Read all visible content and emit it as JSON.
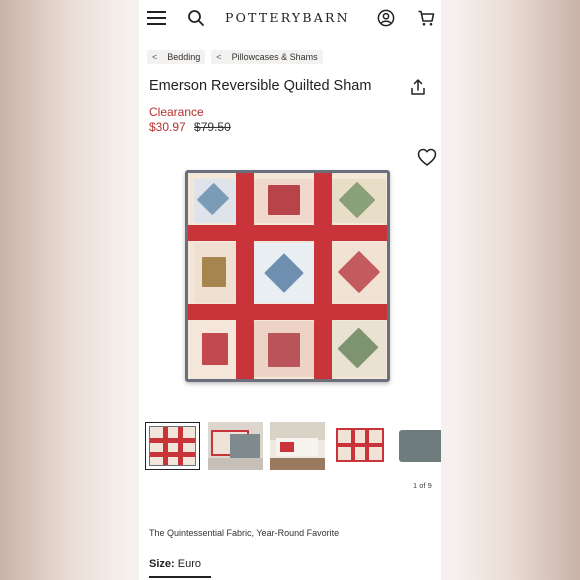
{
  "header": {
    "brand": "POTTERYBARN",
    "icons": [
      "menu-icon",
      "search-icon",
      "account-icon",
      "cart-icon"
    ]
  },
  "breadcrumbs": [
    {
      "label": "Bedding"
    },
    {
      "label": "Pillowcases & Shams"
    }
  ],
  "product": {
    "title": "Emerson Reversible Quilted Sham",
    "clearance_label": "Clearance",
    "sale_price": "$30.97",
    "original_price": "$79.50",
    "tagline": "The Quintessential Fabric, Year-Round Favorite"
  },
  "gallery": {
    "counter": "1 of 9",
    "thumb_count": 5,
    "selected_index": 0
  },
  "options": {
    "size_label": "Size:",
    "size_value": "Euro"
  },
  "colors": {
    "accent_red": "#b5302f",
    "quilt_red": "#c9343b",
    "border_navy": "#6b6e7b"
  }
}
